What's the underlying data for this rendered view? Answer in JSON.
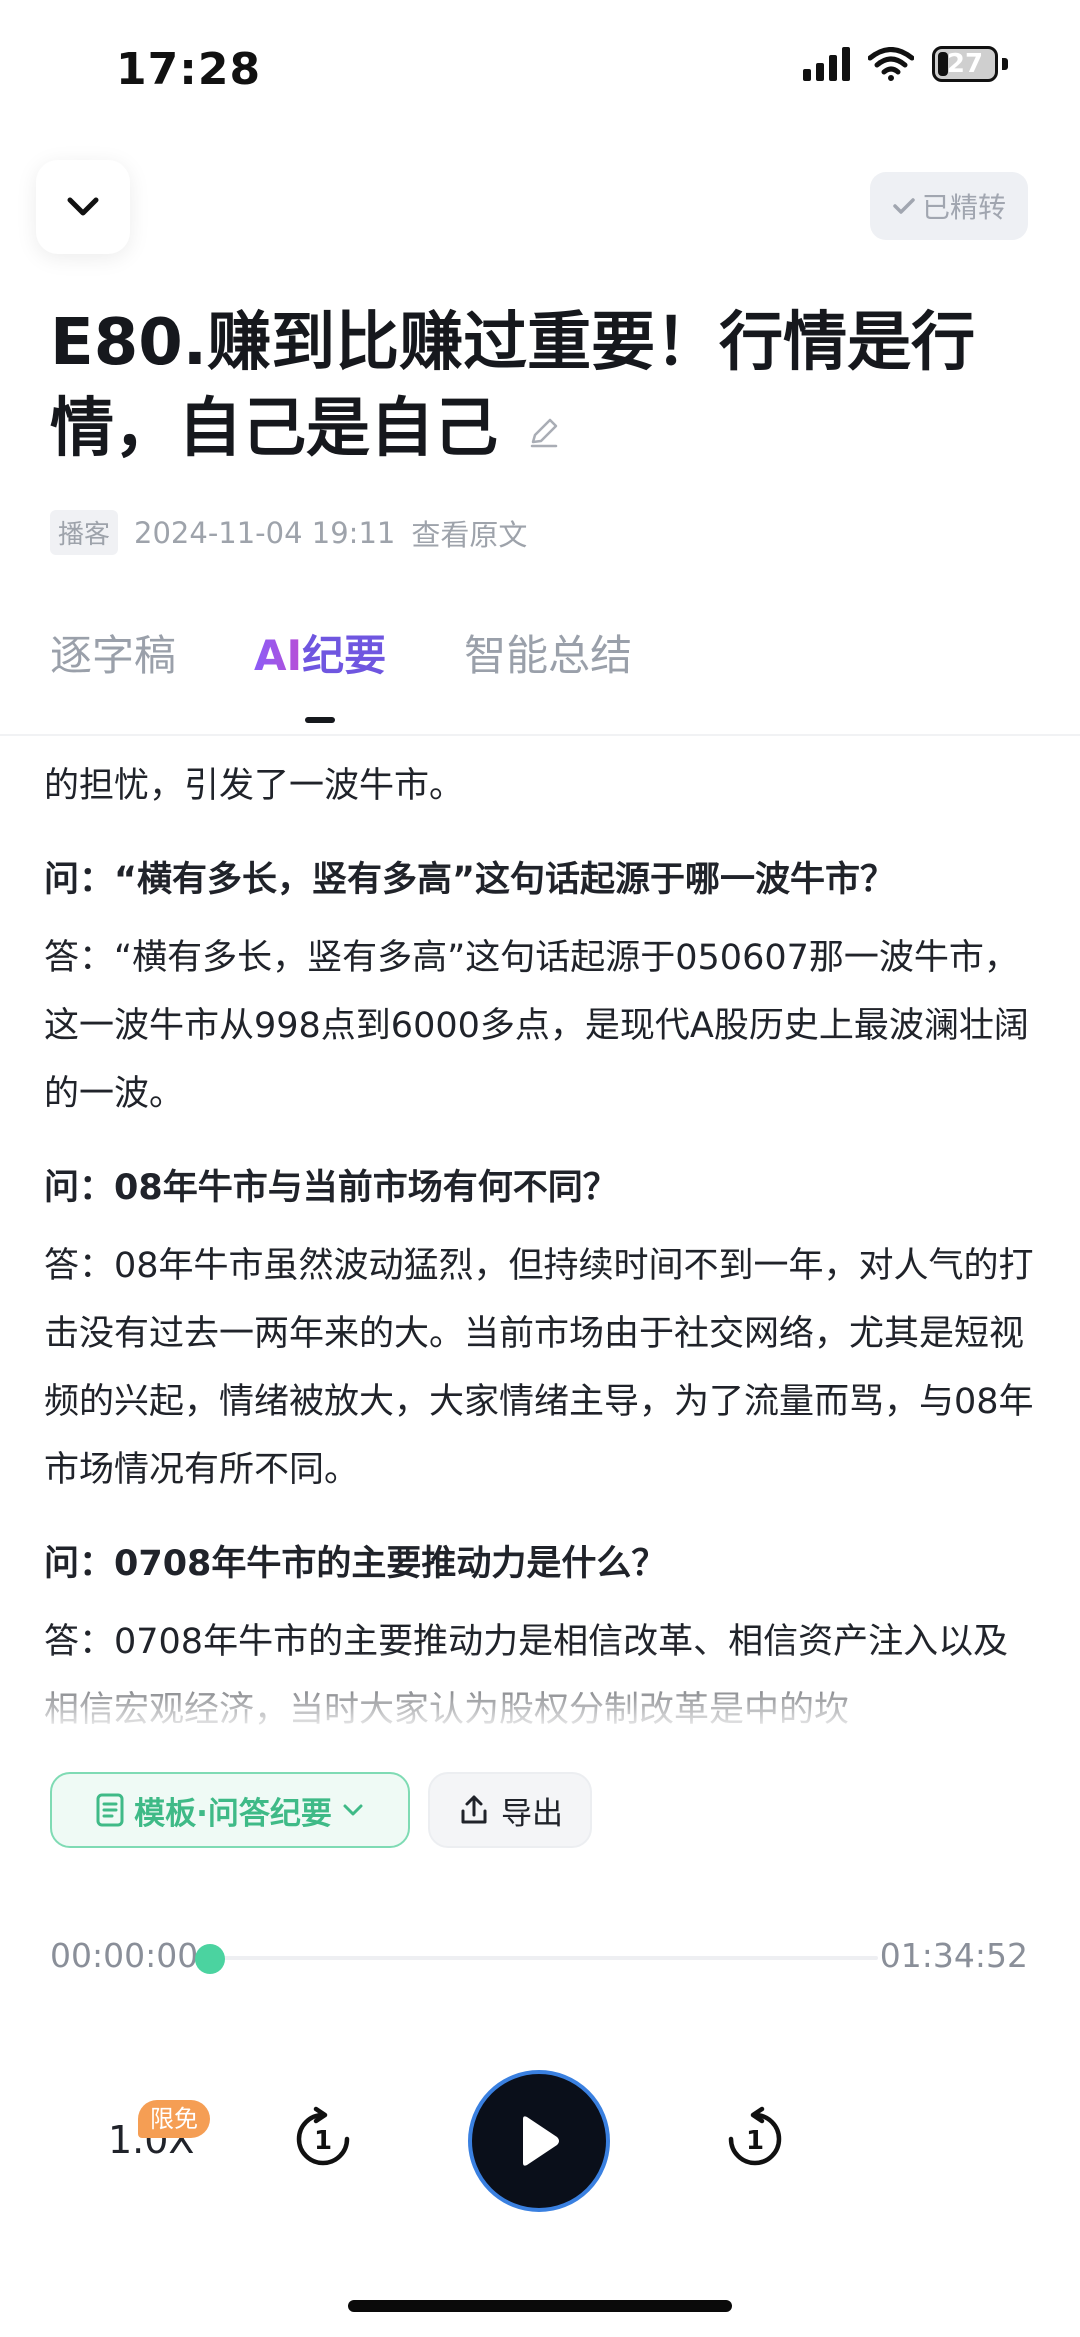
{
  "status_bar": {
    "time": "17:28",
    "battery": "27"
  },
  "header": {
    "badge_label": "已精转"
  },
  "episode": {
    "title": "E80.赚到比赚过重要！行情是行情，自己是自己",
    "source_tag": "播客",
    "datetime": "2024-11-04 19:11",
    "view_original": "查看原文"
  },
  "tabs": [
    {
      "label": "逐字稿",
      "active": false
    },
    {
      "label": "纪要",
      "prefix": "AI",
      "active": true
    },
    {
      "label": "智能总结",
      "active": false
    }
  ],
  "content": {
    "lead": "的担忧，引发了一波牛市。",
    "qa": [
      {
        "q": "问：“横有多长，竖有多高”这句话起源于哪一波牛市？",
        "a": "答：“横有多长，竖有多高”这句话起源于050607那一波牛市，这一波牛市从998点到6000多点，是现代A股历史上最波澜壮阔的一波。"
      },
      {
        "q": "问：08年牛市与当前市场有何不同？",
        "a": "答：08年牛市虽然波动猛烈，但持续时间不到一年，对人气的打击没有过去一两年来的大。当前市场由于社交网络，尤其是短视频的兴起，情绪被放大，大家情绪主导，为了流量而骂，与08年市场情况有所不同。"
      },
      {
        "q": "问：0708年牛市的主要推动力是什么？",
        "a": "答：0708年牛市的主要推动力是相信改革、相信资产注入以及相信宏观经济，当时大家认为股权分制改革是中的坎"
      }
    ]
  },
  "actions": {
    "template_label": "模板·问答纪要",
    "export_label": "导出"
  },
  "player": {
    "current_time": "00:00:00",
    "total_time": "01:34:52",
    "progress": 0,
    "speed": "1.0X",
    "speed_badge": "限免",
    "rewind_seconds": "1",
    "forward_seconds": "1"
  },
  "colors": {
    "accent_green": "#4bd3a0",
    "accent_purple": "#8b5cf6",
    "play_button": "#0a0f1a"
  }
}
